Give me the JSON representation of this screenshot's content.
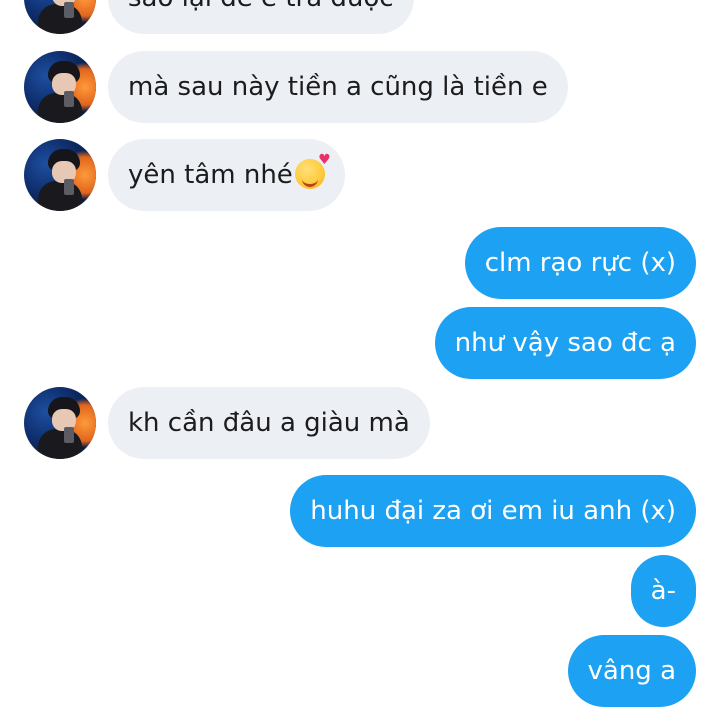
{
  "messages": [
    {
      "direction": "incoming",
      "text": "sao lại để e trả được"
    },
    {
      "direction": "incoming",
      "text": "mà sau này tiền a cũng là tiền e"
    },
    {
      "direction": "incoming",
      "text": "yên tâm nhé",
      "emoji": "smiling-face-with-hearts-icon"
    },
    {
      "direction": "outgoing",
      "text": "clm rạo rực (x)"
    },
    {
      "direction": "outgoing",
      "text": "như vậy sao đc ạ"
    },
    {
      "direction": "incoming",
      "text": "kh cần đâu a giàu mà"
    },
    {
      "direction": "outgoing",
      "text": "huhu đại za ơi em iu anh (x)"
    },
    {
      "direction": "outgoing",
      "text": "à-"
    },
    {
      "direction": "outgoing",
      "text": "vâng a"
    }
  ],
  "colors": {
    "incoming_bubble": "#eceff3",
    "outgoing_bubble": "#1da1f2",
    "incoming_text": "#1c1c1e",
    "outgoing_text": "#ffffff"
  }
}
